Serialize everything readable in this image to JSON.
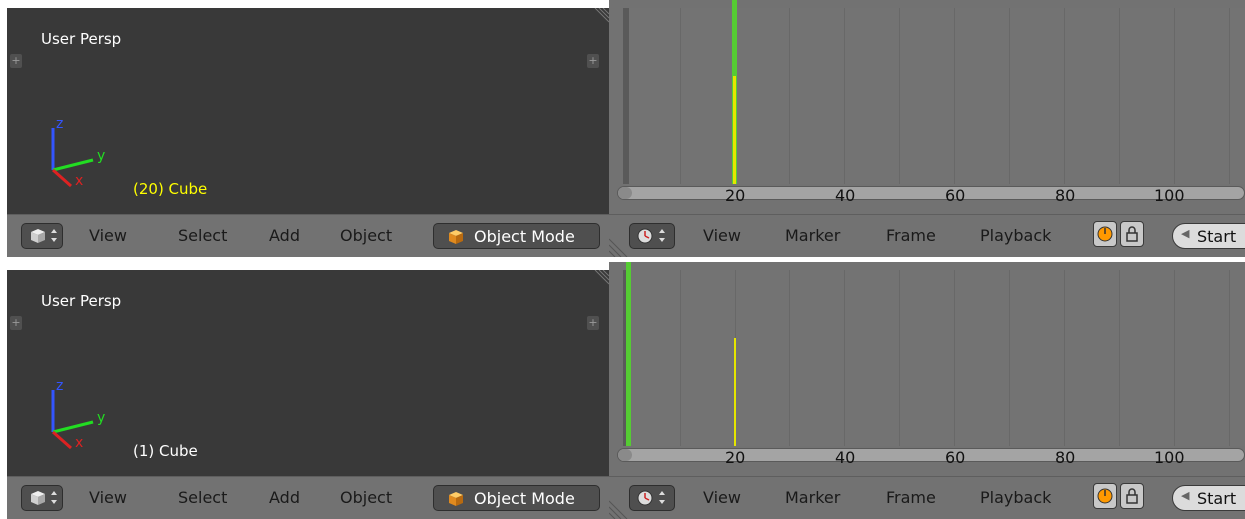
{
  "panels": [
    {
      "viewport": {
        "view_label": "User Persp",
        "object_label": "(20) Cube",
        "object_label_color": "#ffff00",
        "axis_labels": {
          "x": "x",
          "y": "y",
          "z": "z"
        }
      },
      "viewport_header": {
        "menu": [
          "View",
          "Select",
          "Add",
          "Object"
        ],
        "mode": "Object Mode"
      },
      "timeline": {
        "ticks": [
          "20",
          "40",
          "60",
          "80",
          "100"
        ],
        "current_frame": 20,
        "frame_marker_color": "#ffff00",
        "playhead_color": "#55cc33",
        "header_menu": [
          "View",
          "Marker",
          "Frame",
          "Playback"
        ],
        "start_label": "Start"
      }
    },
    {
      "viewport": {
        "view_label": "User Persp",
        "object_label": "(1) Cube",
        "object_label_color": "#ffffff",
        "axis_labels": {
          "x": "x",
          "y": "y",
          "z": "z"
        }
      },
      "viewport_header": {
        "menu": [
          "View",
          "Select",
          "Add",
          "Object"
        ],
        "mode": "Object Mode"
      },
      "timeline": {
        "ticks": [
          "20",
          "40",
          "60",
          "80",
          "100"
        ],
        "current_frame": 1,
        "frame_marker_color": "#ffff00",
        "playhead_color": "#55cc33",
        "header_menu": [
          "View",
          "Marker",
          "Frame",
          "Playback"
        ],
        "start_label": "Start"
      }
    }
  ]
}
